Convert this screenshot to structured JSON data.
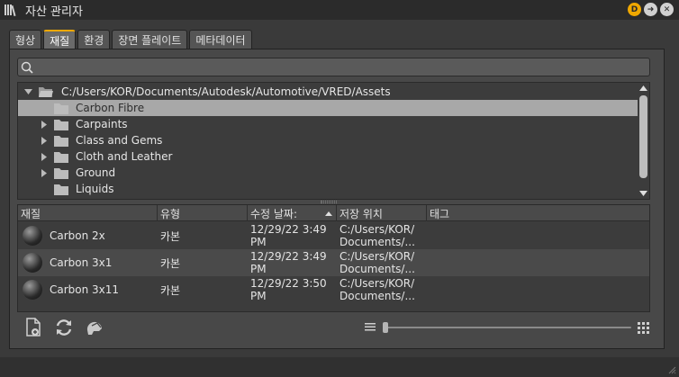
{
  "window": {
    "title": "자산 관리자"
  },
  "title_buttons": [
    {
      "icon": "dock-d-icon",
      "label": "D"
    },
    {
      "icon": "arrow-right-icon",
      "label": "➜"
    },
    {
      "icon": "close-icon",
      "label": "✕"
    }
  ],
  "tabs": [
    {
      "label": "형상",
      "active": false
    },
    {
      "label": "재질",
      "active": true
    },
    {
      "label": "환경",
      "active": false
    },
    {
      "label": "장면 플레이트",
      "active": false
    },
    {
      "label": "메타데이터",
      "active": false
    }
  ],
  "search": {
    "placeholder": "",
    "value": ""
  },
  "tree": {
    "root": "C:/Users/KOR/Documents/Autodesk/Automotive/VRED/Assets",
    "items": [
      {
        "label": "Carbon Fibre",
        "selected": true,
        "expandable": false
      },
      {
        "label": "Carpaints",
        "selected": false,
        "expandable": true
      },
      {
        "label": "Class and Gems",
        "selected": false,
        "expandable": true
      },
      {
        "label": "Cloth and Leather",
        "selected": false,
        "expandable": true
      },
      {
        "label": "Ground",
        "selected": false,
        "expandable": true
      },
      {
        "label": "Liquids",
        "selected": false,
        "expandable": false
      }
    ]
  },
  "table": {
    "headers": {
      "material": "재질",
      "type": "유형",
      "modified": "수정 날짜:",
      "location": "저장 위치",
      "tags": "태그"
    },
    "rows": [
      {
        "name": "Carbon 2x",
        "type": "카본",
        "date1": "12/29/22 3:49",
        "date2": "PM",
        "loc1": "C:/Users/KOR/",
        "loc2": "Documents/...",
        "tags": ""
      },
      {
        "name": "Carbon 3x1",
        "type": "카본",
        "date1": "12/29/22 3:49",
        "date2": "PM",
        "loc1": "C:/Users/KOR/",
        "loc2": "Documents/...",
        "tags": ""
      },
      {
        "name": "Carbon 3x11",
        "type": "카본",
        "date1": "12/29/22 3:50",
        "date2": "PM",
        "loc1": "C:/Users/KOR/",
        "loc2": "Documents/...",
        "tags": ""
      }
    ]
  },
  "bottom_toolbar": {
    "icons": [
      "new-file-icon",
      "refresh-icon",
      "material-helmet-icon"
    ],
    "zoom_level": 0
  },
  "colors": {
    "accent": "#f0a800",
    "selection": "#a8a8a8"
  }
}
